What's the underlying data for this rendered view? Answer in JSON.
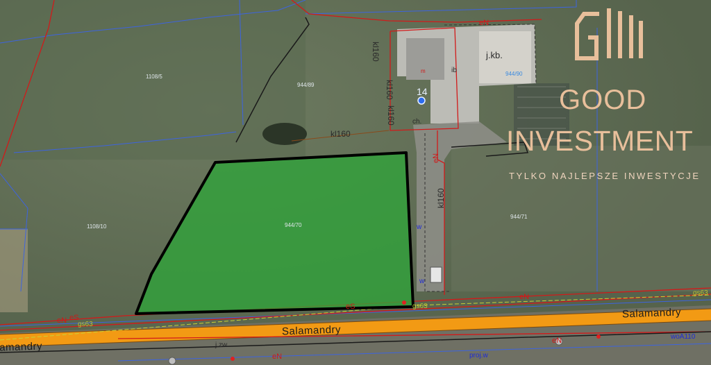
{
  "map": {
    "parcels": [
      "1108/5",
      "944/89",
      "1108/10",
      "944/70",
      "944/71",
      "944/90"
    ],
    "buildings": {
      "main_label": "j.kb.",
      "house_number": "14",
      "shed_label": "ch.",
      "small_label": "ib"
    },
    "utilities": {
      "kl160": "kl160",
      "eN": "eN",
      "eS": "eS",
      "gs63": "gs63",
      "w": "w",
      "woA110": "woA110",
      "proj_w": "proj.w",
      "jzw": "j.zw.",
      "m": "m"
    },
    "street": "Salamandry"
  },
  "brand": {
    "name": "GOOD",
    "name2": "INVESTMENT",
    "tagline": "TYLKO NAJLEPSZE INWESTYCJE",
    "color": "#e8bf9b"
  },
  "colors": {
    "plot_fill": "#2fa43a",
    "plot_border": "#000000",
    "road": "#f29a14",
    "utility_red": "#d21a1a",
    "boundary_blue": "#2c56d8"
  }
}
